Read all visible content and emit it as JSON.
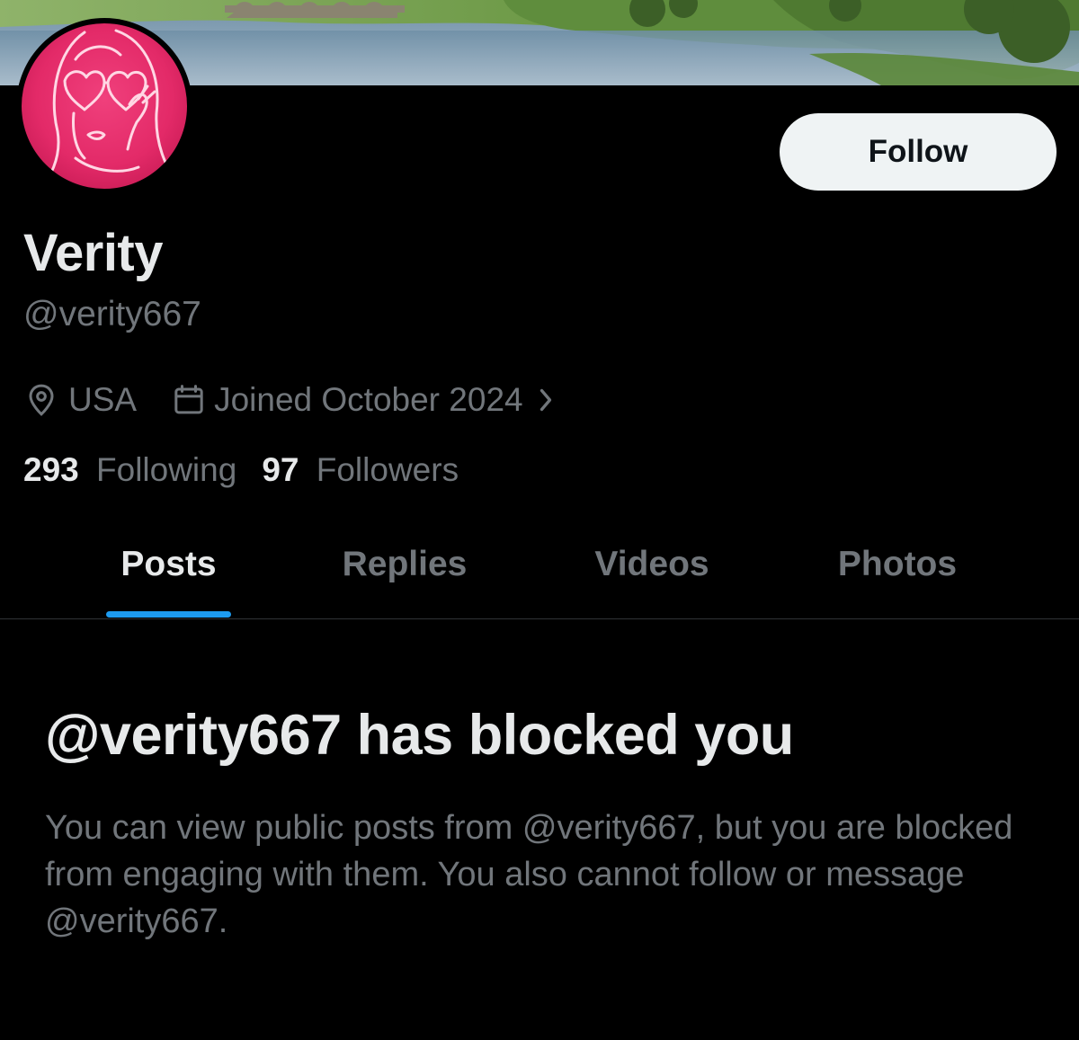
{
  "profile": {
    "display_name": "Verity",
    "handle": "@verity667",
    "location": "USA",
    "joined": "Joined October 2024",
    "following_count": "293",
    "following_label": "Following",
    "followers_count": "97",
    "followers_label": "Followers"
  },
  "actions": {
    "follow_label": "Follow"
  },
  "tabs": [
    {
      "label": "Posts",
      "active": true
    },
    {
      "label": "Replies",
      "active": false
    },
    {
      "label": "Videos",
      "active": false
    },
    {
      "label": "Photos",
      "active": false
    }
  ],
  "blocked": {
    "title": "@verity667 has blocked you",
    "message": "You can view public posts from @verity667, but you are blocked from engaging with them. You also cannot follow or message @verity667."
  },
  "icons": {
    "location": "location-pin-icon",
    "calendar": "calendar-icon",
    "chevron": "chevron-right-icon"
  },
  "colors": {
    "background": "#000000",
    "primary_text": "#e7e9ea",
    "secondary_text": "#71767b",
    "accent": "#1d9bf0",
    "avatar_pink": "#e32a68"
  }
}
